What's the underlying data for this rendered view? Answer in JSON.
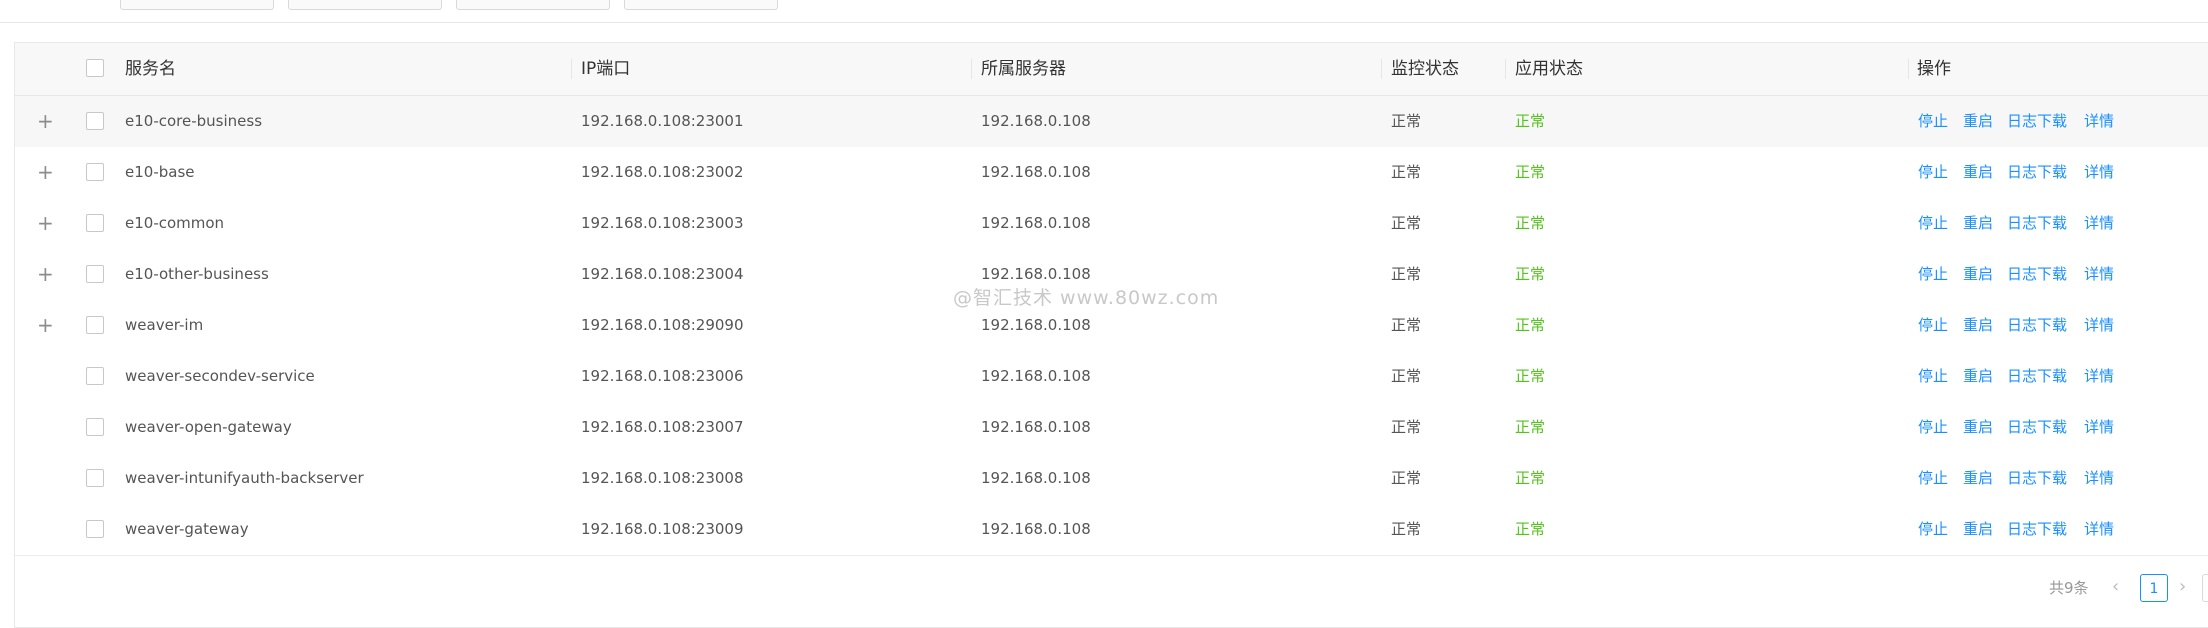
{
  "table": {
    "headers": {
      "service_name": "服务名",
      "ip_port": "IP端口",
      "server": "所属服务器",
      "monitor_status": "监控状态",
      "app_status": "应用状态",
      "actions": "操作"
    },
    "rows": [
      {
        "name": "e10-core-business",
        "ip_port": "192.168.0.108:23001",
        "server": "192.168.0.108",
        "monitor": "正常",
        "app": "正常",
        "expandable": true
      },
      {
        "name": "e10-base",
        "ip_port": "192.168.0.108:23002",
        "server": "192.168.0.108",
        "monitor": "正常",
        "app": "正常",
        "expandable": true
      },
      {
        "name": "e10-common",
        "ip_port": "192.168.0.108:23003",
        "server": "192.168.0.108",
        "monitor": "正常",
        "app": "正常",
        "expandable": true
      },
      {
        "name": "e10-other-business",
        "ip_port": "192.168.0.108:23004",
        "server": "192.168.0.108",
        "monitor": "正常",
        "app": "正常",
        "expandable": true
      },
      {
        "name": "weaver-im",
        "ip_port": "192.168.0.108:29090",
        "server": "192.168.0.108",
        "monitor": "正常",
        "app": "正常",
        "expandable": true
      },
      {
        "name": "weaver-secondev-service",
        "ip_port": "192.168.0.108:23006",
        "server": "192.168.0.108",
        "monitor": "正常",
        "app": "正常",
        "expandable": false
      },
      {
        "name": "weaver-open-gateway",
        "ip_port": "192.168.0.108:23007",
        "server": "192.168.0.108",
        "monitor": "正常",
        "app": "正常",
        "expandable": false
      },
      {
        "name": "weaver-intunifyauth-backserver",
        "ip_port": "192.168.0.108:23008",
        "server": "192.168.0.108",
        "monitor": "正常",
        "app": "正常",
        "expandable": false
      },
      {
        "name": "weaver-gateway",
        "ip_port": "192.168.0.108:23009",
        "server": "192.168.0.108",
        "monitor": "正常",
        "app": "正常",
        "expandable": false
      }
    ],
    "row_actions": {
      "stop": "停止",
      "restart": "重启",
      "log_download": "日志下载",
      "details": "详情"
    }
  },
  "pagination": {
    "total": "共9条",
    "current_page": "1",
    "prev_icon": "chevron-left-icon",
    "next_icon": "chevron-right-icon"
  },
  "watermark": "@智汇技术 www.80wz.com",
  "colors": {
    "link": "#1890ff",
    "status_ok": "#52c41a",
    "header_bg": "#f8f8f8"
  }
}
